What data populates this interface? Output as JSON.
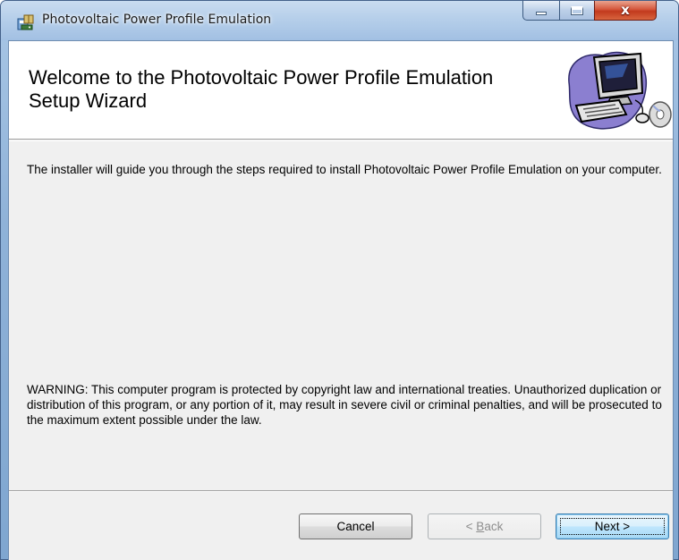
{
  "window": {
    "title": "Photovoltaic Power Profile Emulation",
    "icon": "installer-icon",
    "caption_buttons": [
      "minimize-icon",
      "maximize-icon",
      "close-icon"
    ],
    "close_glyph": "x"
  },
  "banner": {
    "title": "Welcome to the Photovoltaic Power Profile Emulation Setup Wizard",
    "art": "computer-setup-icon"
  },
  "body": {
    "intro": "The installer will guide you through the steps required to install Photovoltaic Power Profile Emulation on your computer.",
    "warning": "WARNING: This computer program is protected by copyright law and international treaties. Unauthorized duplication or distribution of this program, or any portion of it, may result in severe civil or criminal penalties, and will be prosecuted to the maximum extent possible under the law."
  },
  "buttons": {
    "cancel": "Cancel",
    "back_prefix": "< ",
    "back_accel": "B",
    "back_rest": "ack",
    "next": "Next >",
    "back_enabled": false,
    "default_button": "next"
  }
}
